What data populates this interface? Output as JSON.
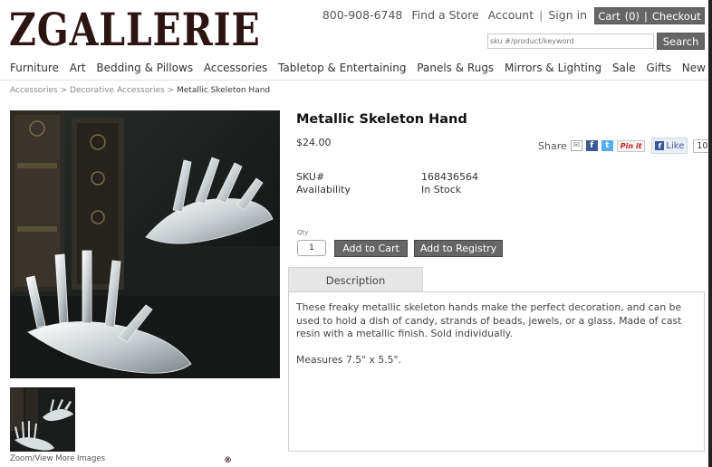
{
  "brand": {
    "logo_text": "ZGALLERIE",
    "logo_mark": "®"
  },
  "utility": {
    "phone": "800-908-6748",
    "find_store": "Find a Store",
    "account": "Account",
    "separator": "|",
    "sign_in": "Sign in"
  },
  "cart": {
    "label": "Cart",
    "count": "(0)",
    "separator": "|",
    "checkout": "Checkout"
  },
  "search": {
    "placeholder": "sku #/product/keyword",
    "button": "Search"
  },
  "nav": {
    "items": [
      "Furniture",
      "Art",
      "Bedding & Pillows",
      "Accessories",
      "Tabletop & Entertaining",
      "Panels & Rugs",
      "Mirrors & Lighting",
      "Sale",
      "Gifts",
      "New"
    ]
  },
  "breadcrumb": {
    "level1": "Accessories",
    "level2": "Decorative Accessories",
    "separator": ">",
    "current": "Metallic Skeleton Hand"
  },
  "gallery": {
    "zoom_label": "Zoom/View More Images"
  },
  "product": {
    "title": "Metallic Skeleton Hand",
    "price": "$24.00",
    "sku_label": "SKU#",
    "sku_value": "168436564",
    "availability_label": "Availability",
    "availability_value": "In Stock"
  },
  "share": {
    "label": "Share",
    "mail_icon": "mail-icon",
    "pin_label": "Pin it",
    "like_label": "Like",
    "like_count": "10"
  },
  "purchase": {
    "qty_label": "Qty",
    "qty_value": "1",
    "add_to_cart": "Add to Cart",
    "add_to_registry": "Add to Registry"
  },
  "tabs": {
    "description_label": "Description",
    "description_text": "These freaky metallic skeleton hands make the perfect decoration, and can be used to hold a dish of candy, strands of beads, jewels, or a glass. Made of cast resin with a metallic finish. Sold individually.",
    "measures_text": "Measures 7.5\" x 5.5\"."
  },
  "colors": {
    "brand_dark": "#2b1411",
    "button_gray": "#666666",
    "facebook": "#3b5998",
    "twitter": "#55acee",
    "pinterest": "#cb2027"
  }
}
